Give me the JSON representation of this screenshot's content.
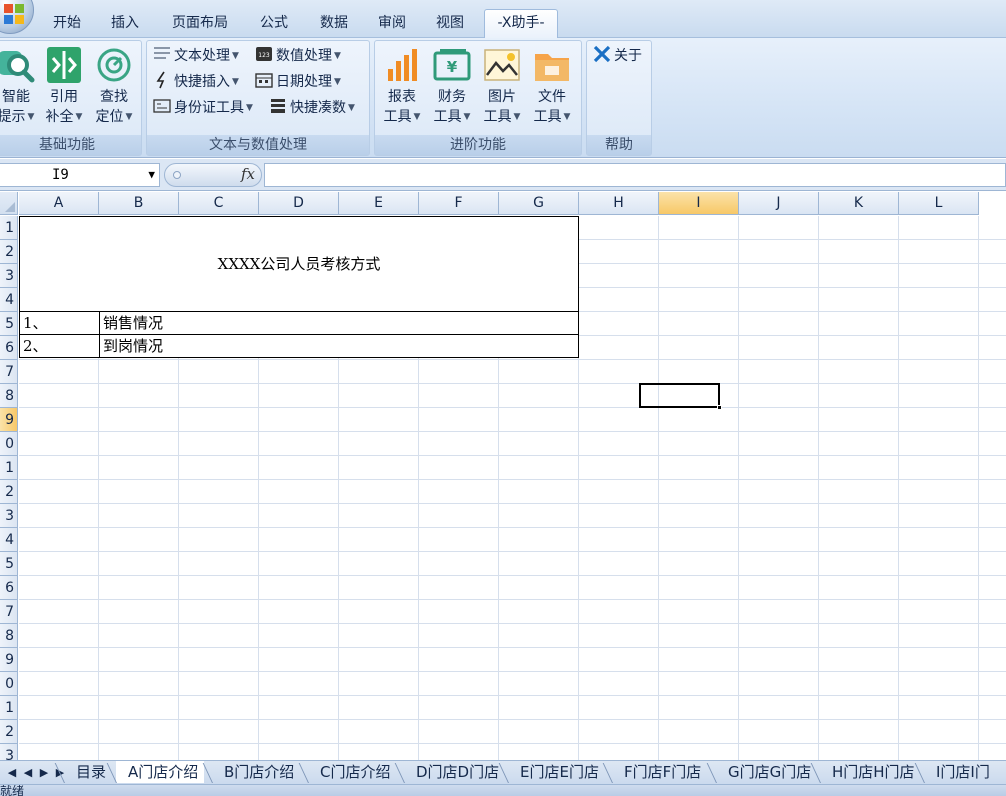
{
  "tabs": [
    "开始",
    "插入",
    "页面布局",
    "公式",
    "数据",
    "审阅",
    "视图",
    "-X助手-"
  ],
  "active_tab": "-X助手-",
  "ribbon": {
    "groups": [
      {
        "label": "基础功能",
        "buttons": [
          {
            "line1": "智能",
            "line2": "提示",
            "has_menu": true,
            "icon": "search-icon"
          },
          {
            "line1": "引用",
            "line2": "补全",
            "has_menu": true,
            "icon": "merge-icon"
          },
          {
            "line1": "查找",
            "line2": "定位",
            "has_menu": true,
            "icon": "locate-icon"
          }
        ]
      },
      {
        "label": "文本与数值处理",
        "items": [
          {
            "label": "文本处理",
            "icon": "text-icon"
          },
          {
            "label": "快捷插入",
            "icon": "lightning-icon"
          },
          {
            "label": "身份证工具",
            "icon": "id-card-icon"
          },
          {
            "label": "数值处理",
            "icon": "number-icon"
          },
          {
            "label": "日期处理",
            "icon": "calendar-icon"
          },
          {
            "label": "快捷凑数",
            "icon": "stack-icon"
          }
        ]
      },
      {
        "label": "进阶功能",
        "buttons": [
          {
            "line1": "报表",
            "line2": "工具",
            "icon": "bar-chart-icon"
          },
          {
            "line1": "财务",
            "line2": "工具",
            "icon": "finance-icon"
          },
          {
            "line1": "图片",
            "line2": "工具",
            "icon": "picture-icon"
          },
          {
            "line1": "文件",
            "line2": "工具",
            "icon": "folder-icon"
          }
        ]
      },
      {
        "label": "帮助",
        "items": [
          {
            "label": "关于",
            "icon": "x-logo-icon"
          }
        ]
      }
    ]
  },
  "formula_bar": {
    "name_box": "I9",
    "fx": "fx",
    "formula": ""
  },
  "columns": [
    "A",
    "B",
    "C",
    "D",
    "E",
    "F",
    "G",
    "H",
    "I",
    "J",
    "K",
    "L"
  ],
  "selected_column": "I",
  "row_labels": [
    "1",
    "2",
    "3",
    "4",
    "5",
    "6",
    "7",
    "8",
    "9",
    "0",
    "1",
    "2",
    "3",
    "4",
    "5",
    "6",
    "7",
    "8",
    "9",
    "0",
    "1",
    "2",
    "3"
  ],
  "selected_row_index": 8,
  "sheet": {
    "title": "XXXX公司人员考核方式",
    "rows": [
      {
        "num": "1、",
        "text": "销售情况"
      },
      {
        "num": "2、",
        "text": "到岗情况"
      }
    ]
  },
  "sheet_tabs": [
    "目录",
    "A门店介绍",
    "B门店介绍",
    "C门店介绍",
    "D门店D门店",
    "E门店E门店",
    "F门店F门店",
    "G门店G门店",
    "H门店H门店",
    "I门店I门"
  ],
  "active_sheet": "A门店介绍",
  "status_text": "就绪",
  "colors": {
    "accent": "#f7c868",
    "ribbon": "#d6e5f6",
    "grid_line": "#d6dfec"
  }
}
